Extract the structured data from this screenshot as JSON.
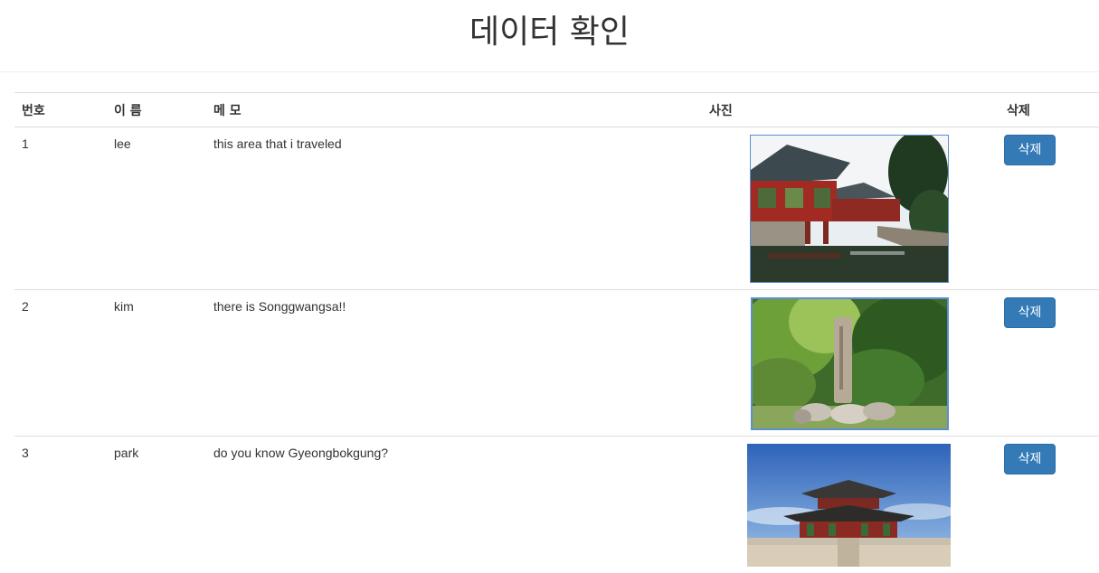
{
  "header": {
    "title": "데이터 확인"
  },
  "table": {
    "columns": [
      "번호",
      "이 름",
      "메 모",
      "사진",
      "삭제"
    ],
    "rows": [
      {
        "no": "1",
        "name": "lee",
        "memo": "this area that i traveled",
        "photo": "traditional-pavilion-pond-photo",
        "delete_label": "삭제"
      },
      {
        "no": "2",
        "name": "kim",
        "memo": "there is Songgwangsa!!",
        "photo": "stone-monument-forest-photo",
        "delete_label": "삭제"
      },
      {
        "no": "3",
        "name": "park",
        "memo": "do you know Gyeongbokgung?",
        "photo": "palace-hall-blue-sky-photo",
        "delete_label": "삭제"
      }
    ]
  },
  "colors": {
    "button_primary": "#337ab7",
    "border": "#dddddd"
  }
}
